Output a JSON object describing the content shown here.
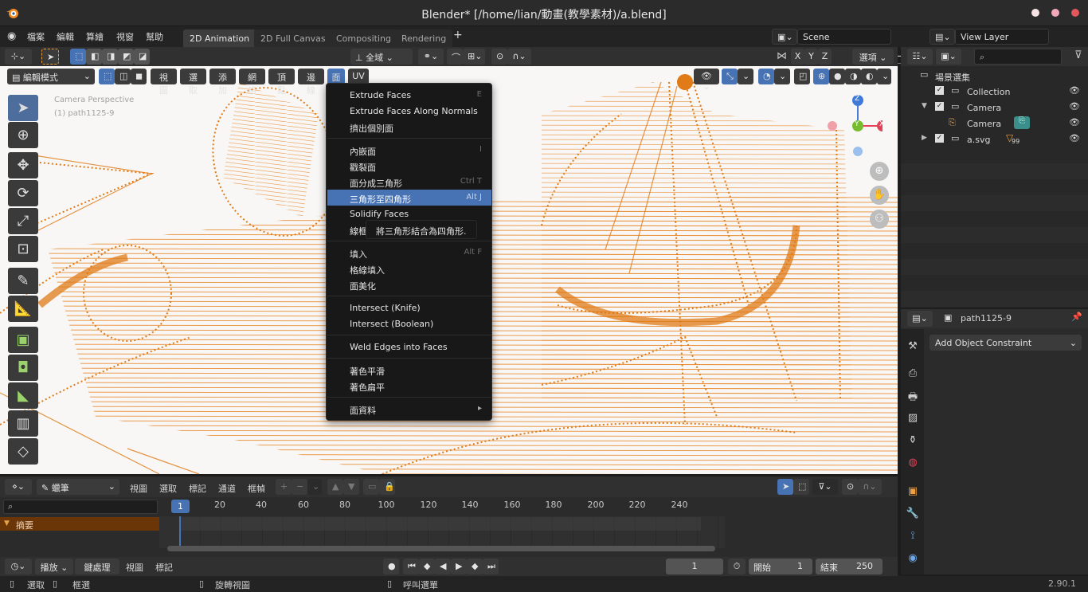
{
  "window": {
    "title": "Blender* [/home/lian/動畫(教學素材)/a.blend]",
    "close_color": "#e2575b",
    "min_color": "#f1a9ba"
  },
  "menubar": {
    "items": [
      "檔案",
      "編輯",
      "算繪",
      "視窗",
      "幫助"
    ],
    "workspaces": [
      "2D Animation",
      "2D Full Canvas",
      "Compositing",
      "Rendering"
    ],
    "add_tab": "+",
    "scene": "Scene",
    "view_layer": "View Layer"
  },
  "tool_header": {
    "transform_orientation": "全域",
    "axes": [
      "X",
      "Y",
      "Z"
    ],
    "options": "選項"
  },
  "viewport_header": {
    "mode": "編輯模式",
    "menus": [
      "視圖",
      "選取",
      "添加",
      "網格",
      "頂點",
      "邊線",
      "面",
      "UV"
    ],
    "active_menu": "面"
  },
  "viewport": {
    "overlay_line1": "Camera Perspective",
    "overlay_line2": "(1) path1125-9",
    "mesh_color": "#e07b17",
    "gizmo": {
      "z": "Z",
      "y": "Y",
      "x": "X"
    }
  },
  "face_menu": {
    "sections": [
      [
        {
          "label": "Extrude Faces",
          "shortcut": "E"
        },
        {
          "label": "Extrude Faces Along Normals",
          "shortcut": ""
        },
        {
          "label": "擠出個別面",
          "shortcut": ""
        }
      ],
      [
        {
          "label": "內嵌面",
          "shortcut": "I"
        },
        {
          "label": "戳裂面",
          "shortcut": ""
        },
        {
          "label": "面分成三角形",
          "shortcut": "Ctrl T"
        },
        {
          "label": "三角形至四角形",
          "shortcut": "Alt J"
        },
        {
          "label": "Solidify Faces",
          "shortcut": ""
        },
        {
          "label": "線框",
          "shortcut": ""
        }
      ],
      [
        {
          "label": "填入",
          "shortcut": "Alt F"
        },
        {
          "label": "格線填入",
          "shortcut": ""
        },
        {
          "label": "面美化",
          "shortcut": ""
        }
      ],
      [
        {
          "label": "Intersect (Knife)",
          "shortcut": ""
        },
        {
          "label": "Intersect (Boolean)",
          "shortcut": ""
        }
      ],
      [
        {
          "label": "Weld Edges into Faces",
          "shortcut": ""
        }
      ],
      [
        {
          "label": "著色平滑",
          "shortcut": ""
        },
        {
          "label": "著色扁平",
          "shortcut": ""
        }
      ],
      [
        {
          "label": "面資料",
          "shortcut": "▸"
        }
      ]
    ],
    "highlighted": "三角形至四角形",
    "tooltip": "將三角形結合為四角形."
  },
  "outliner": {
    "root": "場景選集",
    "rows": [
      {
        "label": "Collection",
        "depth": 1,
        "icon": "collection-icon"
      },
      {
        "label": "Camera",
        "depth": 1,
        "icon": "collection-icon"
      },
      {
        "label": "Camera",
        "depth": 2,
        "icon": "camera-icon"
      },
      {
        "label": "a.svg",
        "depth": 1,
        "icon": "collection-icon",
        "badge": "99"
      }
    ]
  },
  "properties": {
    "object_name": "path1125-9",
    "add_constraint": "Add Object Constraint"
  },
  "dopesheet": {
    "mode": "蠟筆",
    "menus": [
      "視圖",
      "選取",
      "標記",
      "通道",
      "框幀"
    ],
    "summary": "摘要",
    "ruler": [
      "1",
      "20",
      "40",
      "60",
      "80",
      "100",
      "120",
      "140",
      "160",
      "180",
      "200",
      "220",
      "240"
    ],
    "current_frame_marker": "1"
  },
  "playback": {
    "menus": [
      "播放",
      "鍵處理",
      "視圖",
      "標記"
    ],
    "current_frame": "1",
    "start_label": "開始",
    "start_value": "1",
    "end_label": "結束",
    "end_value": "250"
  },
  "statusbar": {
    "items": [
      "選取",
      "框選",
      "旋轉視圖",
      "呼叫選單"
    ],
    "version": "2.90.1"
  }
}
